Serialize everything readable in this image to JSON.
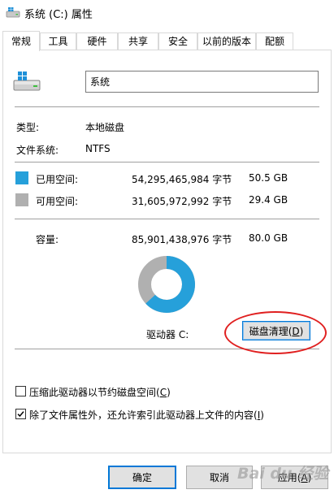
{
  "window": {
    "title": "系统 (C:) 属性"
  },
  "tabs": [
    {
      "label": "常规",
      "active": true
    },
    {
      "label": "工具"
    },
    {
      "label": "硬件"
    },
    {
      "label": "共享"
    },
    {
      "label": "安全"
    },
    {
      "label": "以前的版本"
    },
    {
      "label": "配额"
    }
  ],
  "general": {
    "drive_name": "系统",
    "type_label": "类型:",
    "type_value": "本地磁盘",
    "fs_label": "文件系统:",
    "fs_value": "NTFS",
    "used": {
      "label": "已用空间:",
      "bytes": "54,295,465,984 字节",
      "size": "50.5 GB",
      "color": "#26a0da"
    },
    "free": {
      "label": "可用空间:",
      "bytes": "31,605,972,992 字节",
      "size": "29.4 GB",
      "color": "#b0b0b0"
    },
    "capacity": {
      "label": "容量:",
      "bytes": "85,901,438,976 字节",
      "size": "80.0 GB"
    },
    "used_fraction": 0.632,
    "drive_label": "驱动器 C:",
    "cleanup_button": {
      "text": "磁盘清理(",
      "key": "D",
      "suffix": ")"
    },
    "compress_checkbox": {
      "text": "压缩此驱动器以节约磁盘空间(",
      "key": "C",
      "suffix": ")",
      "checked": false
    },
    "index_checkbox": {
      "text": "除了文件属性外，还允许索引此驱动器上文件的内容(",
      "key": "I",
      "suffix": ")",
      "checked": true
    }
  },
  "buttons": {
    "ok": "确定",
    "cancel": "取消",
    "apply": {
      "text": "应用(",
      "key": "A",
      "suffix": ")"
    }
  },
  "watermark": "Bai du 经验",
  "icons": {
    "title": "drive-icon",
    "drive": "windows-drive-icon"
  }
}
